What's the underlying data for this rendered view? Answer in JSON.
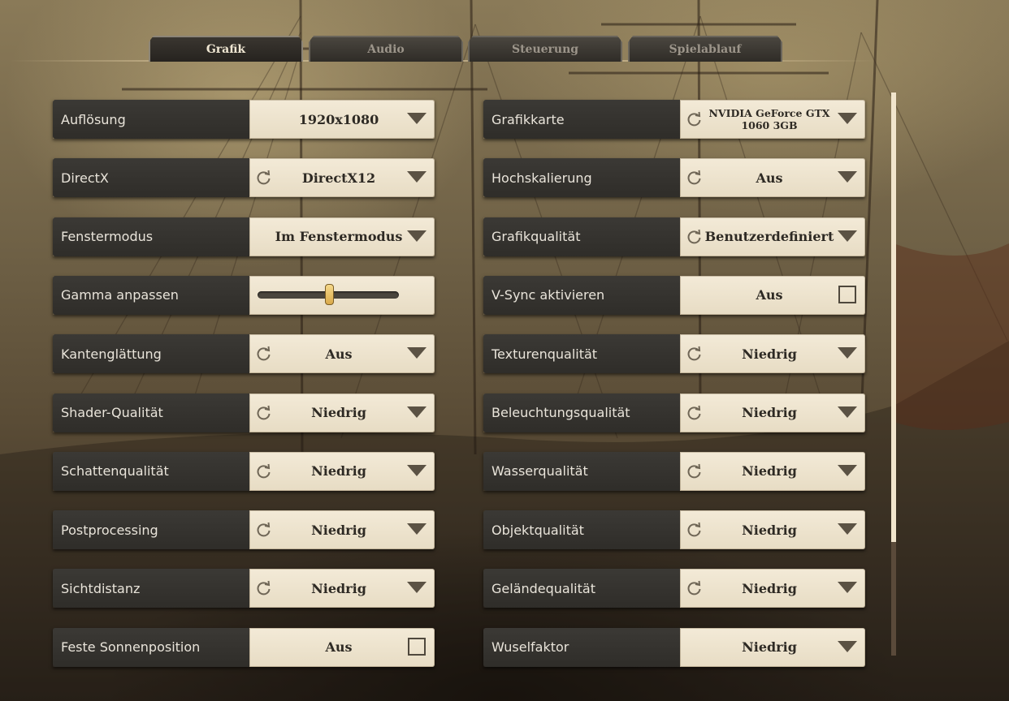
{
  "tabs": [
    {
      "label": "Grafik",
      "active": true
    },
    {
      "label": "Audio",
      "active": false
    },
    {
      "label": "Steuerung",
      "active": false
    },
    {
      "label": "Spielablauf",
      "active": false
    }
  ],
  "left_settings": [
    {
      "label": "Auflösung",
      "value": "1920x1080",
      "kind": "dropdown",
      "reset": false
    },
    {
      "label": "DirectX",
      "value": "DirectX12",
      "kind": "dropdown",
      "reset": true
    },
    {
      "label": "Fenstermodus",
      "value": "Im Fenstermodus",
      "kind": "dropdown",
      "reset": false
    },
    {
      "label": "Gamma anpassen",
      "value": "",
      "kind": "slider",
      "reset": false,
      "level": 0.5
    },
    {
      "label": "Kantenglättung",
      "value": "Aus",
      "kind": "dropdown",
      "reset": true
    },
    {
      "label": "Shader-Qualität",
      "value": "Niedrig",
      "kind": "dropdown",
      "reset": true
    },
    {
      "label": "Schattenqualität",
      "value": "Niedrig",
      "kind": "dropdown",
      "reset": true
    },
    {
      "label": "Postprocessing",
      "value": "Niedrig",
      "kind": "dropdown",
      "reset": true
    },
    {
      "label": "Sichtdistanz",
      "value": "Niedrig",
      "kind": "dropdown",
      "reset": true
    },
    {
      "label": "Feste Sonnenposition",
      "value": "Aus",
      "kind": "checkbox",
      "reset": false,
      "checked": false
    }
  ],
  "right_settings": [
    {
      "label": "Grafikkarte",
      "value": "NVIDIA GeForce GTX 1060 3GB",
      "kind": "dropdown",
      "reset": true,
      "small": true
    },
    {
      "label": "Hochskalierung",
      "value": "Aus",
      "kind": "dropdown",
      "reset": true
    },
    {
      "label": "Grafikqualität",
      "value": "Benutzerdefiniert",
      "kind": "dropdown",
      "reset": true
    },
    {
      "label": "V-Sync aktivieren",
      "value": "Aus",
      "kind": "checkbox",
      "reset": false,
      "checked": false
    },
    {
      "label": "Texturenqualität",
      "value": "Niedrig",
      "kind": "dropdown",
      "reset": true
    },
    {
      "label": "Beleuchtungsqualität",
      "value": "Niedrig",
      "kind": "dropdown",
      "reset": true
    },
    {
      "label": "Wasserqualität",
      "value": "Niedrig",
      "kind": "dropdown",
      "reset": true
    },
    {
      "label": "Objektqualität",
      "value": "Niedrig",
      "kind": "dropdown",
      "reset": true
    },
    {
      "label": "Geländequalität",
      "value": "Niedrig",
      "kind": "dropdown",
      "reset": true
    },
    {
      "label": "Wuselfaktor",
      "value": "Niedrig",
      "kind": "dropdown",
      "reset": false
    }
  ],
  "scrollbar": {
    "visible_fraction": 0.8,
    "position": 0.0
  },
  "icons": {
    "reset": "reset-icon",
    "dropdown": "dropdown-arrow-icon",
    "checkbox": "checkbox-icon"
  },
  "colors": {
    "label_bg": "#34322e",
    "control_bg": "#efe5cf",
    "accent": "#d9a94a"
  }
}
